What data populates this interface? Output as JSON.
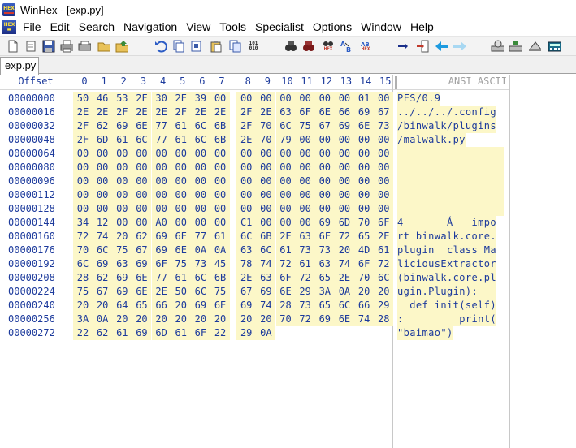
{
  "window": {
    "title": "WinHex - [exp.py]"
  },
  "menu": {
    "icon": "hex-app-icon",
    "items": [
      "File",
      "Edit",
      "Search",
      "Navigation",
      "View",
      "Tools",
      "Specialist",
      "Options",
      "Window",
      "Help"
    ]
  },
  "toolbar": {
    "buttons": [
      "new-file-icon",
      "open-file-icon",
      "save-icon",
      "print-icon",
      "properties-icon",
      "open-folder-icon",
      "export-icon",
      "undo-icon",
      "copy-icon",
      "cut-icon",
      "paste-icon",
      "paste-special-icon",
      "binary-copy-icon",
      "find-text-icon",
      "find-hex-icon",
      "replace-text-icon",
      "replace-hex-icon",
      "go-to-offset-icon",
      "go-to-icon",
      "jump-icon",
      "back-icon",
      "forward-icon",
      "disk-editor-icon",
      "ram-editor-icon",
      "view-icon",
      "calculator-icon"
    ],
    "text_labels": {
      "binary": "101\n010",
      "hex1": "HEX",
      "hex2": "HEX"
    }
  },
  "tabs": [
    {
      "label": "exp.py"
    }
  ],
  "hex_view": {
    "offset_header": "Offset",
    "columns": [
      "0",
      "1",
      "2",
      "3",
      "4",
      "5",
      "6",
      "7",
      "8",
      "9",
      "10",
      "11",
      "12",
      "13",
      "14",
      "15"
    ],
    "text_header": "ANSI ASCII",
    "rows": [
      {
        "offset": "00000000",
        "bytes": [
          "50",
          "46",
          "53",
          "2F",
          "30",
          "2E",
          "39",
          "00",
          "00",
          "00",
          "00",
          "00",
          "00",
          "00",
          "01",
          "00"
        ],
        "text": "PFS/0.9"
      },
      {
        "offset": "00000016",
        "bytes": [
          "2E",
          "2E",
          "2F",
          "2E",
          "2E",
          "2F",
          "2E",
          "2E",
          "2F",
          "2E",
          "63",
          "6F",
          "6E",
          "66",
          "69",
          "67"
        ],
        "text": "../../../.config"
      },
      {
        "offset": "00000032",
        "bytes": [
          "2F",
          "62",
          "69",
          "6E",
          "77",
          "61",
          "6C",
          "6B",
          "2F",
          "70",
          "6C",
          "75",
          "67",
          "69",
          "6E",
          "73"
        ],
        "text": "/binwalk/plugins"
      },
      {
        "offset": "00000048",
        "bytes": [
          "2F",
          "6D",
          "61",
          "6C",
          "77",
          "61",
          "6C",
          "6B",
          "2E",
          "70",
          "79",
          "00",
          "00",
          "00",
          "00",
          "00"
        ],
        "text": "/malwalk.py"
      },
      {
        "offset": "00000064",
        "bytes": [
          "00",
          "00",
          "00",
          "00",
          "00",
          "00",
          "00",
          "00",
          "00",
          "00",
          "00",
          "00",
          "00",
          "00",
          "00",
          "00"
        ],
        "text": ""
      },
      {
        "offset": "00000080",
        "bytes": [
          "00",
          "00",
          "00",
          "00",
          "00",
          "00",
          "00",
          "00",
          "00",
          "00",
          "00",
          "00",
          "00",
          "00",
          "00",
          "00"
        ],
        "text": ""
      },
      {
        "offset": "00000096",
        "bytes": [
          "00",
          "00",
          "00",
          "00",
          "00",
          "00",
          "00",
          "00",
          "00",
          "00",
          "00",
          "00",
          "00",
          "00",
          "00",
          "00"
        ],
        "text": ""
      },
      {
        "offset": "00000112",
        "bytes": [
          "00",
          "00",
          "00",
          "00",
          "00",
          "00",
          "00",
          "00",
          "00",
          "00",
          "00",
          "00",
          "00",
          "00",
          "00",
          "00"
        ],
        "text": ""
      },
      {
        "offset": "00000128",
        "bytes": [
          "00",
          "00",
          "00",
          "00",
          "00",
          "00",
          "00",
          "00",
          "00",
          "00",
          "00",
          "00",
          "00",
          "00",
          "00",
          "00"
        ],
        "text": ""
      },
      {
        "offset": "00000144",
        "bytes": [
          "34",
          "12",
          "00",
          "00",
          "A0",
          "00",
          "00",
          "00",
          "C1",
          "00",
          "00",
          "00",
          "69",
          "6D",
          "70",
          "6F"
        ],
        "text": "4       Á   impo"
      },
      {
        "offset": "00000160",
        "bytes": [
          "72",
          "74",
          "20",
          "62",
          "69",
          "6E",
          "77",
          "61",
          "6C",
          "6B",
          "2E",
          "63",
          "6F",
          "72",
          "65",
          "2E"
        ],
        "text": "rt binwalk.core."
      },
      {
        "offset": "00000176",
        "bytes": [
          "70",
          "6C",
          "75",
          "67",
          "69",
          "6E",
          "0A",
          "0A",
          "63",
          "6C",
          "61",
          "73",
          "73",
          "20",
          "4D",
          "61"
        ],
        "text": "plugin  class Ma"
      },
      {
        "offset": "00000192",
        "bytes": [
          "6C",
          "69",
          "63",
          "69",
          "6F",
          "75",
          "73",
          "45",
          "78",
          "74",
          "72",
          "61",
          "63",
          "74",
          "6F",
          "72"
        ],
        "text": "liciousExtractor"
      },
      {
        "offset": "00000208",
        "bytes": [
          "28",
          "62",
          "69",
          "6E",
          "77",
          "61",
          "6C",
          "6B",
          "2E",
          "63",
          "6F",
          "72",
          "65",
          "2E",
          "70",
          "6C"
        ],
        "text": "(binwalk.core.pl"
      },
      {
        "offset": "00000224",
        "bytes": [
          "75",
          "67",
          "69",
          "6E",
          "2E",
          "50",
          "6C",
          "75",
          "67",
          "69",
          "6E",
          "29",
          "3A",
          "0A",
          "20",
          "20"
        ],
        "text": "ugin.Plugin):   "
      },
      {
        "offset": "00000240",
        "bytes": [
          "20",
          "20",
          "64",
          "65",
          "66",
          "20",
          "69",
          "6E",
          "69",
          "74",
          "28",
          "73",
          "65",
          "6C",
          "66",
          "29"
        ],
        "text": "  def init(self)"
      },
      {
        "offset": "00000256",
        "bytes": [
          "3A",
          "0A",
          "20",
          "20",
          "20",
          "20",
          "20",
          "20",
          "20",
          "20",
          "70",
          "72",
          "69",
          "6E",
          "74",
          "28"
        ],
        "text": ":         print("
      },
      {
        "offset": "00000272",
        "bytes": [
          "22",
          "62",
          "61",
          "69",
          "6D",
          "61",
          "6F",
          "22",
          "29",
          "0A"
        ],
        "text": "\"baimao\")"
      }
    ],
    "colors": {
      "text": "#1c3a9c",
      "highlight": "#fcf7c8"
    }
  }
}
